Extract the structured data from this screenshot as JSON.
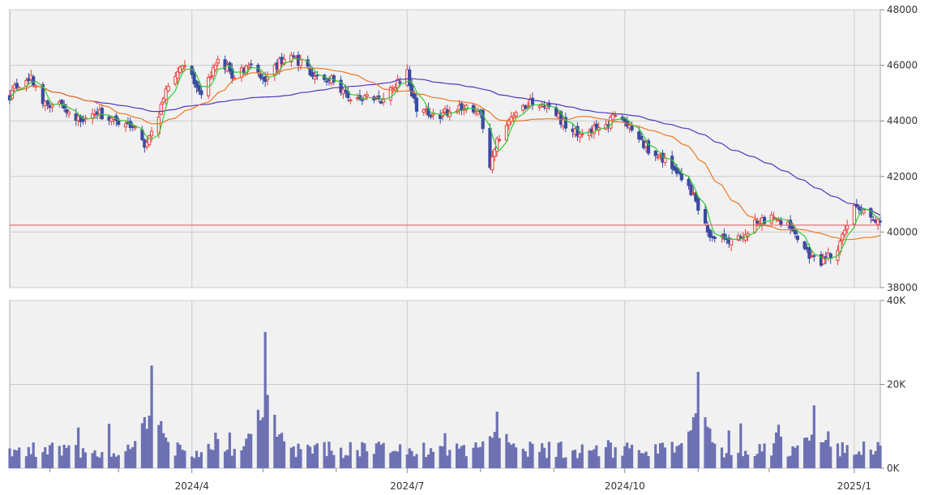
{
  "chart_data": [
    {
      "type": "candlestick",
      "x_range": [
        "2024-01-15",
        "2025-01-17"
      ],
      "ylim": [
        38000,
        48000
      ],
      "y_ticks": [
        38000,
        40000,
        42000,
        44000,
        46000,
        48000
      ],
      "y_tick_labels": [
        "38000",
        "40000",
        "42000",
        "44000",
        "46000",
        "48000"
      ],
      "reference_line": 40250,
      "grid": true,
      "series": [
        {
          "kind": "ohlc",
          "up_color": "#e8413c",
          "down_color": "#3a4aa0"
        },
        {
          "kind": "moving_average",
          "color": "#33cc33"
        },
        {
          "kind": "moving_average",
          "color": "#ee7722"
        },
        {
          "kind": "moving_average",
          "color": "#5533bb"
        }
      ],
      "anchors": [
        [
          "2024-01-15",
          44800
        ],
        [
          "2024-01-18",
          45300
        ],
        [
          "2024-01-24",
          45500
        ],
        [
          "2024-01-30",
          44600
        ],
        [
          "2024-02-05",
          44700
        ],
        [
          "2024-02-12",
          44000
        ],
        [
          "2024-02-20",
          44300
        ],
        [
          "2024-02-28",
          44100
        ],
        [
          "2024-03-07",
          43800
        ],
        [
          "2024-03-12",
          43100
        ],
        [
          "2024-03-18",
          44300
        ],
        [
          "2024-03-24",
          45700
        ],
        [
          "2024-03-29",
          45900
        ],
        [
          "2024-04-05",
          45100
        ],
        [
          "2024-04-12",
          46200
        ],
        [
          "2024-04-19",
          45600
        ],
        [
          "2024-04-26",
          46000
        ],
        [
          "2024-05-02",
          45500
        ],
        [
          "2024-05-08",
          46100
        ],
        [
          "2024-05-14",
          46300
        ],
        [
          "2024-05-22",
          45700
        ],
        [
          "2024-05-30",
          45500
        ],
        [
          "2024-06-06",
          44800
        ],
        [
          "2024-06-14",
          44900
        ],
        [
          "2024-06-20",
          44600
        ],
        [
          "2024-06-26",
          45300
        ],
        [
          "2024-07-01",
          45700
        ],
        [
          "2024-07-05",
          44400
        ],
        [
          "2024-07-12",
          44200
        ],
        [
          "2024-07-19",
          44300
        ],
        [
          "2024-07-25",
          44500
        ],
        [
          "2024-08-01",
          44400
        ],
        [
          "2024-08-05",
          42300
        ],
        [
          "2024-08-08",
          43300
        ],
        [
          "2024-08-14",
          44100
        ],
        [
          "2024-08-22",
          44700
        ],
        [
          "2024-08-30",
          44600
        ],
        [
          "2024-09-06",
          43800
        ],
        [
          "2024-09-12",
          43500
        ],
        [
          "2024-09-18",
          43700
        ],
        [
          "2024-09-24",
          43900
        ],
        [
          "2024-09-27",
          44200
        ],
        [
          "2024-10-01",
          43900
        ],
        [
          "2024-10-08",
          43200
        ],
        [
          "2024-10-15",
          42700
        ],
        [
          "2024-10-22",
          42300
        ],
        [
          "2024-10-29",
          41500
        ],
        [
          "2024-11-05",
          40000
        ],
        [
          "2024-11-12",
          39700
        ],
        [
          "2024-11-19",
          39800
        ],
        [
          "2024-11-25",
          40400
        ],
        [
          "2024-12-02",
          40500
        ],
        [
          "2024-12-09",
          40200
        ],
        [
          "2024-12-16",
          39300
        ],
        [
          "2024-12-23",
          38900
        ],
        [
          "2024-12-30",
          39400
        ],
        [
          "2025-01-06",
          41000
        ],
        [
          "2025-01-10",
          40800
        ],
        [
          "2025-01-17",
          40300
        ]
      ]
    },
    {
      "type": "bar",
      "x_range": [
        "2024-01-15",
        "2025-01-17"
      ],
      "ylim": [
        0,
        40000
      ],
      "y_ticks": [
        0,
        20000,
        40000
      ],
      "y_tick_labels": [
        "0K",
        "20K",
        "40K"
      ],
      "bar_color": "#6d71b3",
      "baseline_volume": 4000,
      "peaks": [
        [
          "2024-03-15",
          24500
        ],
        [
          "2024-05-02",
          32500
        ],
        [
          "2024-05-03",
          17500
        ],
        [
          "2024-08-08",
          13500
        ],
        [
          "2024-11-01",
          23000
        ],
        [
          "2024-12-20",
          15000
        ]
      ]
    }
  ],
  "x_axis": {
    "tick_labels": [
      {
        "date": "2024-04-01",
        "label": "2024/4"
      },
      {
        "date": "2024-07-01",
        "label": "2024/7"
      },
      {
        "date": "2024-10-01",
        "label": "2024/10"
      },
      {
        "date": "2025-01-06",
        "label": "2025/1"
      }
    ],
    "minor_ticks": [
      "2024-02-01",
      "2024-03-01",
      "2024-05-01",
      "2024-06-01",
      "2024-08-01",
      "2024-09-01",
      "2024-11-01",
      "2024-12-01"
    ]
  }
}
